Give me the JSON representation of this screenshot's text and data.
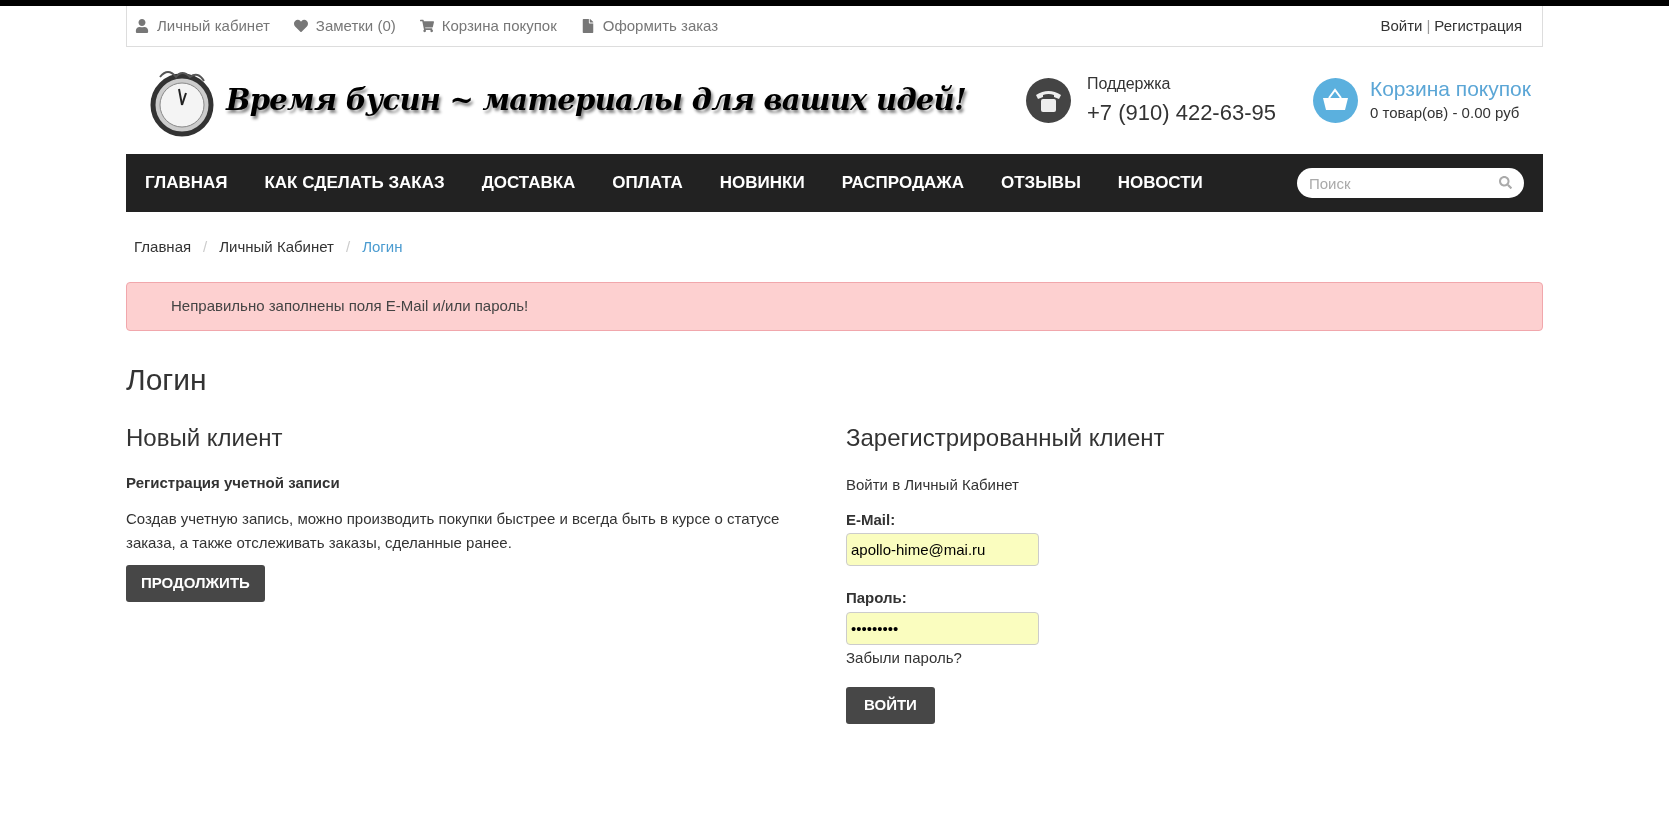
{
  "top_links": [
    {
      "kind": "account",
      "label": "Личный кабинет"
    },
    {
      "kind": "notes",
      "label": "Заметки (0)"
    },
    {
      "kind": "cart",
      "label": "Корзина покупок"
    },
    {
      "kind": "checkout",
      "label": "Оформить заказ"
    }
  ],
  "account_links": {
    "login": "Войти",
    "separator": "|",
    "register": "Регистрация"
  },
  "logo": {
    "text": "Время бусин ~ материалы для ваших идей!"
  },
  "support": {
    "label": "Поддержка",
    "phone": "+7 (910) 422-63-95"
  },
  "cart": {
    "title": "Корзина покупок",
    "summary": "0 товар(ов) - 0.00 руб"
  },
  "nav": [
    "ГЛАВНАЯ",
    "КАК СДЕЛАТЬ ЗАКАЗ",
    "ДОСТАВКА",
    "ОПЛАТА",
    "НОВИНКИ",
    "РАСПРОДАЖА",
    "ОТЗЫВЫ",
    "НОВОСТИ"
  ],
  "search": {
    "placeholder": "Поиск"
  },
  "breadcrumb": [
    {
      "label": "Главная",
      "selected": false
    },
    {
      "label": "Личный Кабинет",
      "selected": false
    },
    {
      "label": "Логин",
      "selected": true
    }
  ],
  "breadcrumb_separator": "/",
  "alert": "Неправильно заполнены поля E-Mail и/или пароль!",
  "page_title": "Логин",
  "new_client": {
    "heading": "Новый клиент",
    "subheading": "Регистрация учетной записи",
    "text": "Создав учетную запись, можно производить покупки быстрее и всегда быть в курсе о статусе заказа, а также отслеживать заказы, сделанные ранее.",
    "button": "ПРОДОЛЖИТЬ"
  },
  "registered_client": {
    "heading": "Зарегистрированный клиент",
    "intro": "Войти в Личный Кабинет",
    "email_label": "E-Mail:",
    "email_value": "apollo-hime@mai.ru",
    "password_label": "Пароль:",
    "password_value": "•••••••••",
    "forgot": "Забыли пароль?",
    "button": "ВОЙТИ"
  }
}
